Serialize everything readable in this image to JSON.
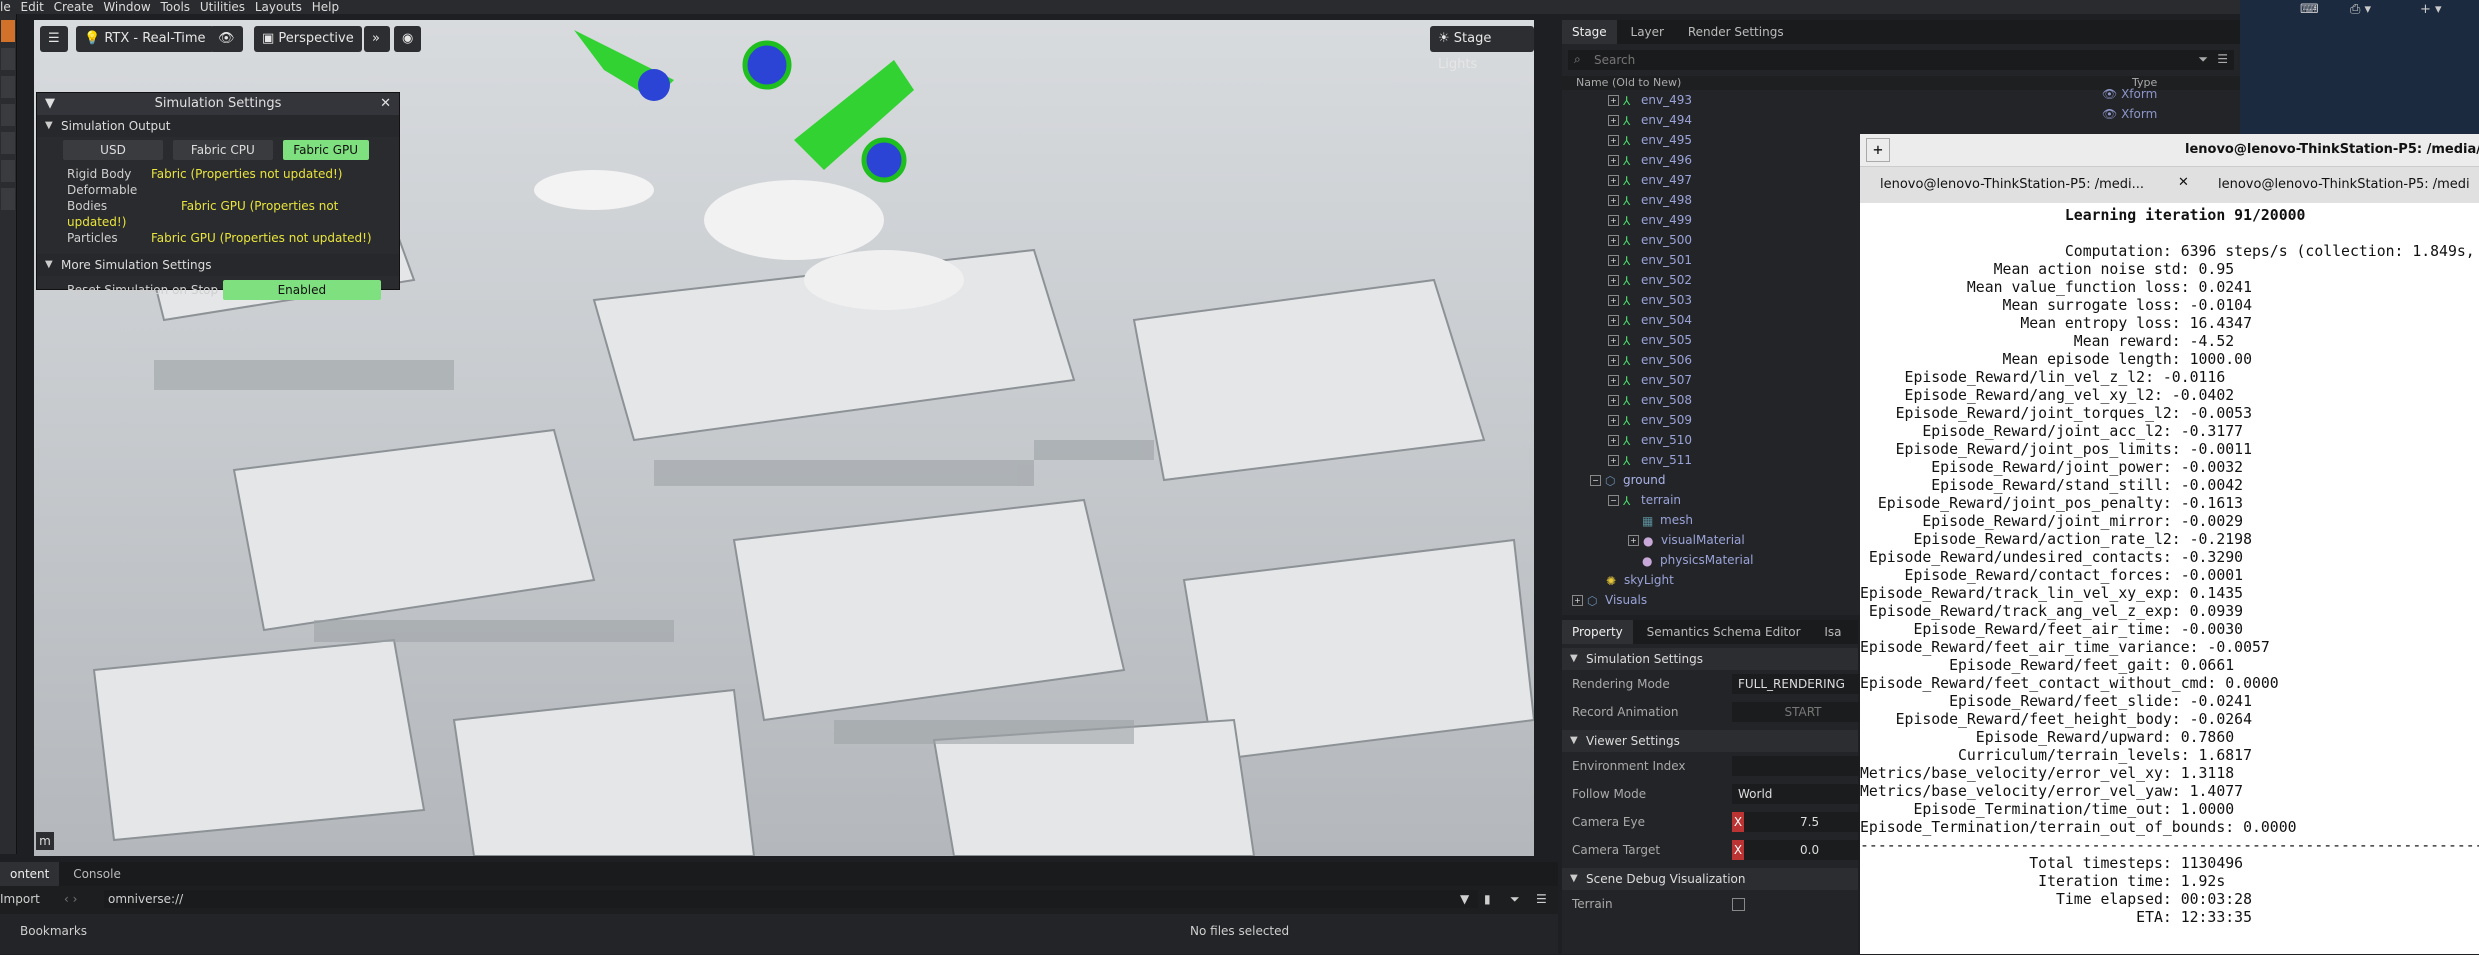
{
  "menubar": [
    "le",
    "Edit",
    "Create",
    "Window",
    "Tools",
    "Utilities",
    "Layouts",
    "Help"
  ],
  "viewport": {
    "renderer": "RTX - Real-Time",
    "camera": "Perspective",
    "lights": "Stage Lights",
    "unit_label": "m"
  },
  "sim_settings": {
    "title": "Simulation Settings",
    "output_header": "Simulation Output",
    "modes": [
      "USD",
      "Fabric CPU",
      "Fabric GPU"
    ],
    "active_mode": "Fabric GPU",
    "rows": [
      {
        "label": "Rigid Body",
        "value": "Fabric (Properties not updated!)"
      },
      {
        "label": "Deformable Bodies",
        "value": "Fabric GPU (Properties not updated!)"
      },
      {
        "label": "Particles",
        "value": "Fabric GPU (Properties not updated!)"
      }
    ],
    "more_header": "More Simulation Settings",
    "reset_label": "Reset Simulation on Stop",
    "reset_value": "Enabled"
  },
  "stage": {
    "tabs": [
      "Stage",
      "Layer",
      "Render Settings"
    ],
    "search_placeholder": "Search",
    "col_name": "Name (Old to New)",
    "col_type": "Type",
    "type_values": [
      "Xform",
      "Xform"
    ],
    "envs": [
      "env_493",
      "env_494",
      "env_495",
      "env_496",
      "env_497",
      "env_498",
      "env_499",
      "env_500",
      "env_501",
      "env_502",
      "env_503",
      "env_504",
      "env_505",
      "env_506",
      "env_507",
      "env_508",
      "env_509",
      "env_510",
      "env_511"
    ],
    "ground": "ground",
    "terrain": "terrain",
    "mesh": "mesh",
    "visual_material": "visualMaterial",
    "physics_material": "physicsMaterial",
    "sky": "skyLight",
    "visuals": "Visuals"
  },
  "props": {
    "tabs": [
      "Property",
      "Semantics Schema Editor",
      "Isa"
    ],
    "sim_header": "Simulation Settings",
    "rendering_mode_label": "Rendering Mode",
    "rendering_mode_value": "FULL_RENDERING",
    "record_label": "Record Animation",
    "record_value": "START",
    "viewer_header": "Viewer Settings",
    "env_index_label": "Environment Index",
    "follow_label": "Follow Mode",
    "follow_value": "World",
    "eye_label": "Camera Eye",
    "eye_value": "7.5",
    "target_label": "Camera Target",
    "target_value": "0.0",
    "debug_header": "Scene Debug Visualization",
    "terrain_label": "Terrain"
  },
  "terminal": {
    "tab_title": "lenovo@lenovo-ThinkStation-P5: /media/",
    "tabs": [
      "lenovo@lenovo-ThinkStation-P5: /medi...",
      "lenovo@lenovo-ThinkStation-P5: /medi"
    ],
    "lines": [
      "                       Learning iteration 91/20000",
      "",
      "                       Computation: 6396 steps/s (collection: 1.849s,",
      "               Mean action noise std: 0.95",
      "            Mean value_function loss: 0.0241",
      "                Mean surrogate loss: -0.0104",
      "                  Mean entropy loss: 16.4347",
      "                        Mean reward: -4.52",
      "                Mean episode length: 1000.00",
      "     Episode_Reward/lin_vel_z_l2: -0.0116",
      "     Episode_Reward/ang_vel_xy_l2: -0.0402",
      "    Episode_Reward/joint_torques_l2: -0.0053",
      "       Episode_Reward/joint_acc_l2: -0.3177",
      "    Episode_Reward/joint_pos_limits: -0.0011",
      "        Episode_Reward/joint_power: -0.0032",
      "        Episode_Reward/stand_still: -0.0042",
      "  Episode_Reward/joint_pos_penalty: -0.1613",
      "       Episode_Reward/joint_mirror: -0.0029",
      "      Episode_Reward/action_rate_l2: -0.2198",
      " Episode_Reward/undesired_contacts: -0.3290",
      "     Episode_Reward/contact_forces: -0.0001",
      "Episode_Reward/track_lin_vel_xy_exp: 0.1435",
      " Episode_Reward/track_ang_vel_z_exp: 0.0939",
      "      Episode_Reward/feet_air_time: -0.0030",
      "Episode_Reward/feet_air_time_variance: -0.0057",
      "          Episode_Reward/feet_gait: 0.0661",
      "Episode_Reward/feet_contact_without_cmd: 0.0000",
      "          Episode_Reward/feet_slide: -0.0241",
      "    Episode_Reward/feet_height_body: -0.0264",
      "             Episode_Reward/upward: 0.7860",
      "           Curriculum/terrain_levels: 1.6817",
      "Metrics/base_velocity/error_vel_xy: 1.3118",
      "Metrics/base_velocity/error_vel_yaw: 1.4077",
      "      Episode_Termination/time_out: 1.0000",
      "Episode_Termination/terrain_out_of_bounds: 0.0000",
      "--------------------------------------------------------------------------------",
      "                   Total timesteps: 1130496",
      "                    Iteration time: 1.92s",
      "                      Time elapsed: 00:03:28",
      "                               ETA: 12:33:35"
    ]
  },
  "bottom": {
    "tabs": [
      "ontent",
      "Console"
    ],
    "import_label": "Import",
    "path_value": "omniverse://",
    "bookmarks": "Bookmarks",
    "no_files": "No files selected"
  }
}
